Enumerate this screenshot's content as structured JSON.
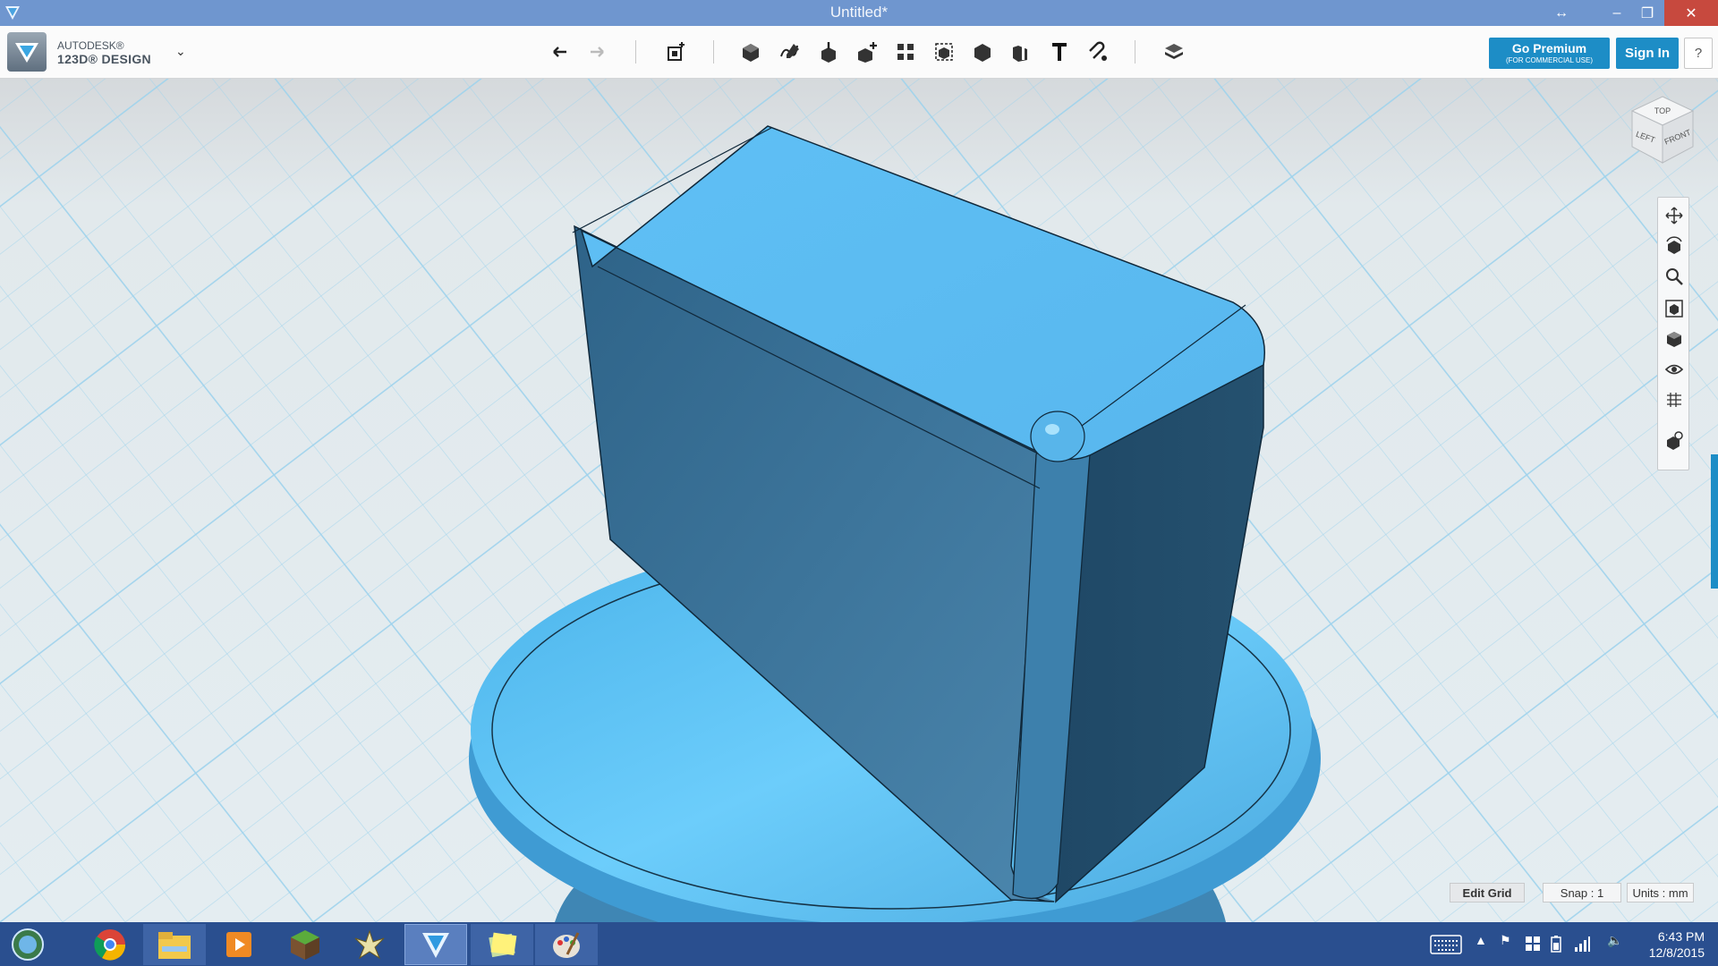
{
  "window": {
    "title": "Untitled*",
    "restore_glyph": "↔",
    "minimize_glyph": "–",
    "maximize_glyph": "❐",
    "close_glyph": "✕"
  },
  "brand": {
    "line1": "AUTODESK®",
    "line2": "123D® DESIGN",
    "menu_caret": "⌄"
  },
  "toolbar": {
    "tools": [
      "undo-icon",
      "redo-icon",
      "transform-icon",
      "primitives-icon",
      "sketch-icon",
      "construct-icon",
      "modify-icon",
      "pattern-icon",
      "grouping-icon",
      "combine-icon",
      "measure-icon",
      "text-icon",
      "snap-icon",
      "material-icon"
    ],
    "premium_label": "Go Premium",
    "premium_sub": "(FOR COMMERCIAL USE)",
    "signin_label": "Sign In",
    "help_label": "?"
  },
  "viewcube": {
    "top": "TOP",
    "left": "LEFT",
    "front": "FRONT"
  },
  "navbar": {
    "tools": [
      "pan-icon",
      "orbit-icon",
      "zoom-icon",
      "fit-icon",
      "view-icon",
      "visibility-icon",
      "grid-icon",
      "materials-icon"
    ]
  },
  "status": {
    "edit_grid": "Edit Grid",
    "snap": "Snap : 1",
    "units": "Units : mm"
  },
  "taskbar": {
    "apps": [
      "start-icon",
      "chrome-icon",
      "file-explorer-icon",
      "media-player-icon",
      "minecraft-icon",
      "game-icon",
      "123d-design-icon",
      "sticky-notes-icon",
      "paint-icon"
    ],
    "time": "6:43 PM",
    "date": "12/8/2015"
  },
  "colors": {
    "titlebar": "#6f96cf",
    "accent": "#1d8dc6",
    "model_light": "#5ec2f6",
    "model_dark": "#2f6a90",
    "taskbar": "#2a4f8f"
  }
}
